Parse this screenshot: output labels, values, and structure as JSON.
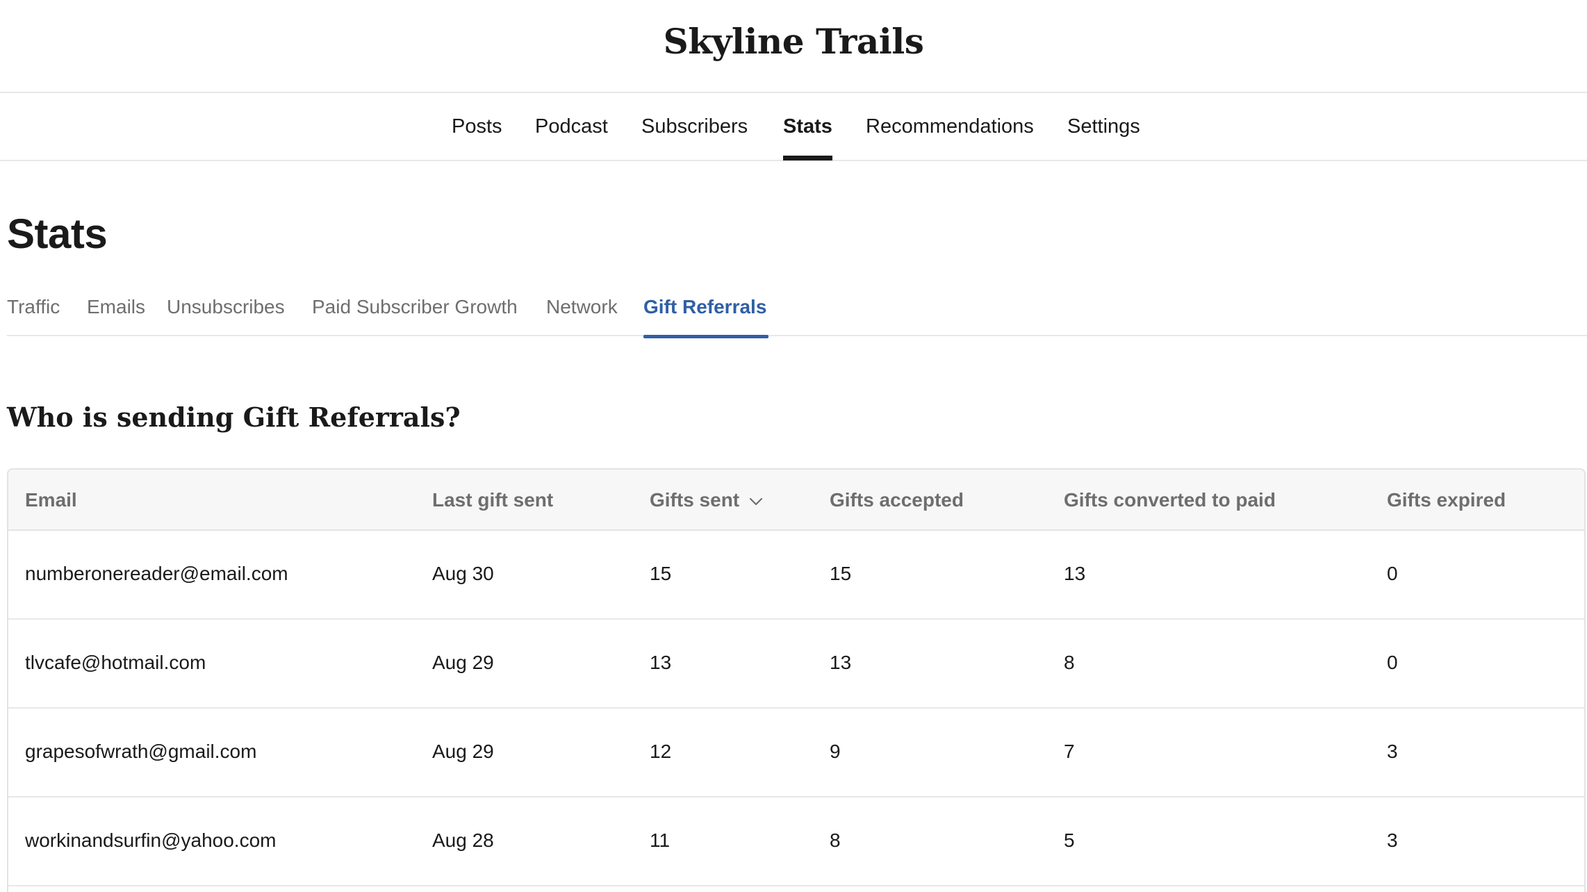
{
  "site": {
    "title": "Skyline Trails"
  },
  "top_nav": {
    "items": [
      {
        "label": "Posts"
      },
      {
        "label": "Podcast"
      },
      {
        "label": "Subscribers"
      },
      {
        "label": "Stats",
        "active": true
      },
      {
        "label": "Recommendations"
      },
      {
        "label": "Settings"
      }
    ]
  },
  "page": {
    "title": "Stats"
  },
  "subtabs": {
    "items": [
      {
        "label": "Traffic"
      },
      {
        "label": "Emails"
      },
      {
        "label": "Unsubscribes"
      },
      {
        "label": "Paid Subscriber Growth"
      },
      {
        "label": "Network"
      },
      {
        "label": "Gift Referrals",
        "active": true
      }
    ]
  },
  "section": {
    "heading": "Who is sending Gift Referrals?"
  },
  "table": {
    "columns": [
      {
        "label": "Email"
      },
      {
        "label": "Last gift sent"
      },
      {
        "label": "Gifts sent",
        "sort_icon": "chevron-down-icon"
      },
      {
        "label": "Gifts accepted"
      },
      {
        "label": "Gifts converted to paid"
      },
      {
        "label": "Gifts expired"
      }
    ],
    "rows": [
      {
        "email": "numberonereader@email.com",
        "last_gift_sent": "Aug 30",
        "gifts_sent": "15",
        "gifts_accepted": "15",
        "gifts_converted": "13",
        "gifts_expired": "0"
      },
      {
        "email": "tlvcafe@hotmail.com",
        "last_gift_sent": "Aug 29",
        "gifts_sent": "13",
        "gifts_accepted": "13",
        "gifts_converted": "8",
        "gifts_expired": "0"
      },
      {
        "email": "grapesofwrath@gmail.com",
        "last_gift_sent": "Aug 29",
        "gifts_sent": "12",
        "gifts_accepted": "9",
        "gifts_converted": "7",
        "gifts_expired": "3"
      },
      {
        "email": "workinandsurfin@yahoo.com",
        "last_gift_sent": "Aug 28",
        "gifts_sent": "11",
        "gifts_accepted": "8",
        "gifts_converted": "5",
        "gifts_expired": "3"
      }
    ]
  },
  "colors": {
    "accent": "#2f5fa6",
    "text": "#1a1a1a",
    "muted": "#6e6e6e",
    "header_bg": "#f7f7f7",
    "border": "#e3e3e3"
  }
}
